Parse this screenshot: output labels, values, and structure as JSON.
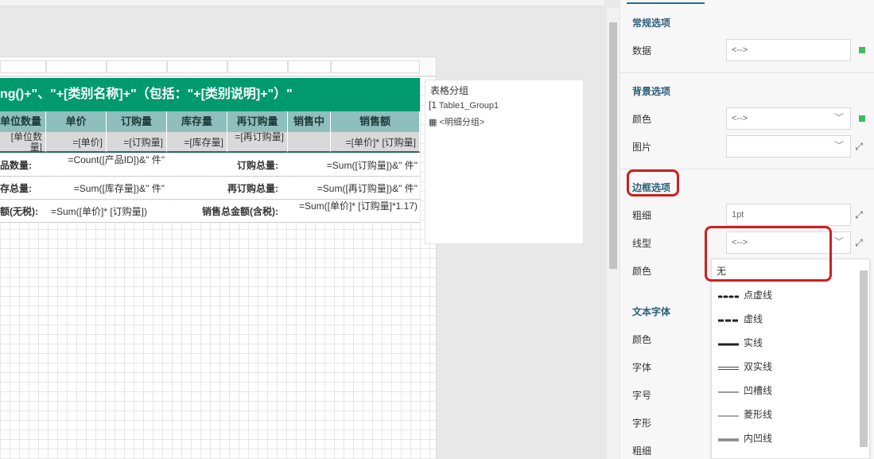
{
  "report": {
    "title": "ng()+\"、\"+[类别名称]+\"（包括：\"+[类别说明]+\"）\"",
    "headers": [
      "单位数量",
      "单价",
      "订购量",
      "库存量",
      "再订购量",
      "销售中",
      "销售额"
    ],
    "detail": [
      "[单位数量]",
      "=[单价]",
      "=[订购量]",
      "=[库存量]",
      "=[再订购量]",
      "",
      "=[单价]* [订购量]"
    ],
    "footer": [
      [
        "品数量:",
        "=Count([产品ID])&\" 件\"",
        "订购总量:",
        "=Sum([订购量])&\" 件\""
      ],
      [
        "存总量:",
        "=Sum([库存量])&\" 件\"",
        "再订购总量:",
        "=Sum([再订购量])&\" 件\""
      ],
      [
        "额(无税):",
        "=Sum([单价]* [订购量])",
        "销售总金额(含税):",
        "=Sum([单价]* [订购量]*1.17)"
      ]
    ]
  },
  "group_panel": {
    "title": "表格分组",
    "items": [
      "Table1_Group1",
      "<明细分组>"
    ]
  },
  "props": {
    "general": {
      "heading": "常规选项",
      "data_label": "数据",
      "data_value": "<-->"
    },
    "background": {
      "heading": "背景选项",
      "color_label": "颜色",
      "color_value": "<-->",
      "image_label": "图片",
      "image_value": ""
    },
    "border": {
      "heading": "边框选项",
      "width_label": "粗细",
      "width_value": "1pt",
      "style_label": "线型",
      "style_value": "<-->",
      "color_label": "颜色"
    },
    "font": {
      "heading": "文本字体",
      "color_label": "颜色",
      "family_label": "字体",
      "size_label": "字号",
      "shape_label": "字形",
      "weight_label": "粗细"
    }
  },
  "line_style_options": [
    "无",
    "点虚线",
    "虚线",
    "实线",
    "双实线",
    "凹槽线",
    "菱形线",
    "内凹线"
  ],
  "colors": {
    "accent": "#009a6e",
    "header": "#8fbfbc",
    "highlight": "#cc2020",
    "indicator": "#3cbd5c"
  }
}
